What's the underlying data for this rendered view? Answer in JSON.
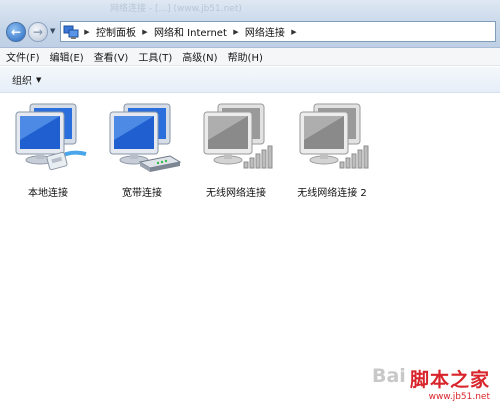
{
  "window": {
    "ghost_title": "网络连接 - [...] (www.jb51.net)"
  },
  "nav": {
    "back_glyph": "←",
    "forward_glyph": "→",
    "history_glyph": "▼"
  },
  "address": {
    "icon": "network-connections-icon",
    "separator": "▶",
    "crumbs": [
      {
        "label": "控制面板"
      },
      {
        "label": "网络和 Internet"
      },
      {
        "label": "网络连接"
      }
    ]
  },
  "menubar": {
    "items": [
      {
        "label": "文件(F)"
      },
      {
        "label": "编辑(E)"
      },
      {
        "label": "查看(V)"
      },
      {
        "label": "工具(T)"
      },
      {
        "label": "高级(N)"
      },
      {
        "label": "帮助(H)"
      }
    ]
  },
  "cmdbar": {
    "organize_label": "组织",
    "caret": "▼"
  },
  "connections": [
    {
      "label": "本地连接",
      "icon": "lan-cable-icon",
      "active": true
    },
    {
      "label": "宽带连接",
      "icon": "modem-icon",
      "active": true
    },
    {
      "label": "无线网络连接",
      "icon": "wireless-signal-icon",
      "active": false
    },
    {
      "label": "无线网络连接 2",
      "icon": "wireless-signal-icon",
      "active": false
    }
  ],
  "colors": {
    "active_screen": "#1f5fd0",
    "inactive_screen": "#8a8a8a",
    "watermark": "#d8252b"
  },
  "watermark": {
    "ghost": "Bai",
    "main": "脚本之家",
    "url": "www.jb51.net"
  }
}
